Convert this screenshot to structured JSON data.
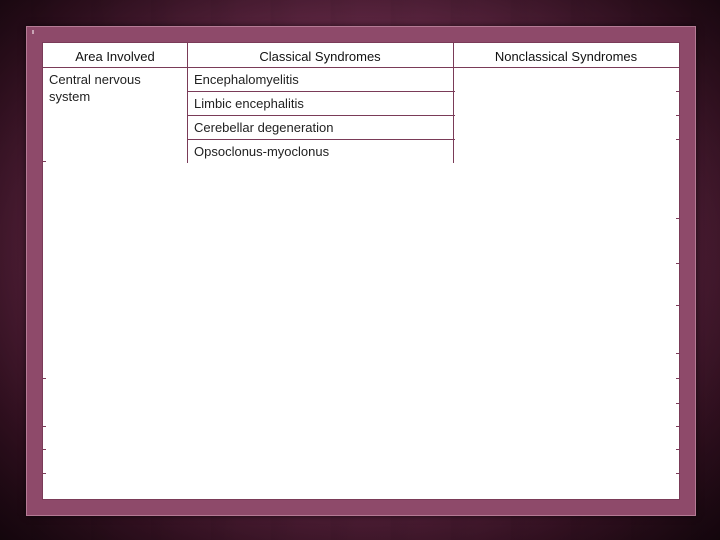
{
  "table": {
    "headers": [
      "Area Involved",
      "Classical Syndromes",
      "Nonclassical Syndromes"
    ],
    "rows": [
      {
        "area": "Central nervous system",
        "classical": [
          "Encephalomyelitis",
          "Limbic encephalitis",
          "Cerebellar degeneration",
          "Opsoclonus-myoclonus"
        ],
        "nonclassical": []
      }
    ]
  },
  "colors": {
    "background": "#6e2e4e",
    "frame": "#8e4a6a",
    "rule": "#7a3b58",
    "slide": "#ffffff"
  }
}
